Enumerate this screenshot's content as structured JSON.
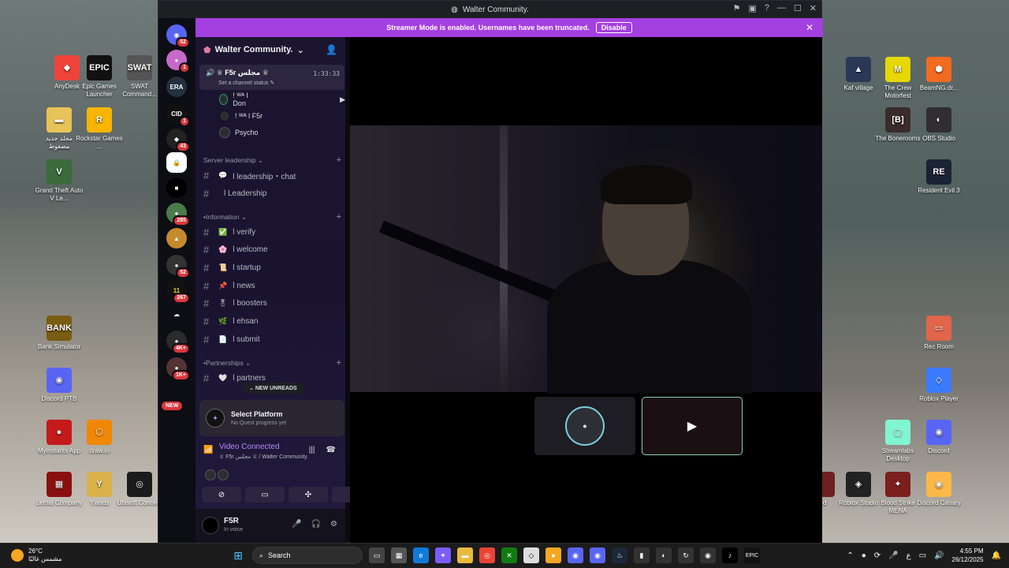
{
  "window": {
    "title": "Walter Community.",
    "streamer_notice": "Streamer Mode is enabled. Usernames have been truncated.",
    "streamer_disable": "Disable"
  },
  "rail": {
    "badges": [
      "52",
      "1",
      "1",
      "43",
      "285",
      "52",
      "267",
      "4K+",
      "1K+"
    ],
    "new_label": "NEW",
    "labels": [
      "ERA",
      "CID"
    ]
  },
  "server": {
    "name": "Walter Community.",
    "voice_channel": "♕ F5r مجلس ♕",
    "voice_time": "1:33:33",
    "voice_status": "Set a channel status",
    "voice_users": [
      "! ᵂᴬ l Don",
      "! ᵂᴬ l F5r",
      "Psycho"
    ],
    "categories": [
      {
        "name": "Server leadership"
      },
      {
        "name": "Information"
      },
      {
        "name": "Partnerships"
      }
    ],
    "channels_leadership": [
      {
        "emoji": "💬",
        "name": "l leadership・chat"
      },
      {
        "emoji": "",
        "name": "l Leadership"
      }
    ],
    "channels_info": [
      {
        "emoji": "✅",
        "name": "l verify"
      },
      {
        "emoji": "🌸",
        "name": "l welcome"
      },
      {
        "emoji": "📜",
        "name": "l startup"
      },
      {
        "emoji": "📌",
        "name": "l news"
      },
      {
        "emoji": "🎖",
        "name": "l boosters"
      },
      {
        "emoji": "🌿",
        "name": "l ehsan"
      },
      {
        "emoji": "📄",
        "name": "l submit"
      }
    ],
    "channels_partner": [
      {
        "emoji": "🤍",
        "name": "l partners"
      }
    ],
    "new_unreads": "NEW UNREADS"
  },
  "quest": {
    "title": "Select Platform",
    "subtitle": "No Quest progress yet"
  },
  "voice": {
    "status": "Video Connected",
    "location": "♕ F5r مجلس ♕ / Walter Community."
  },
  "user": {
    "name": "F5R",
    "status": "In voice"
  },
  "desktop_left": [
    {
      "label": "AnyDesk",
      "color": "#ef443b",
      "glyph": "◆"
    },
    {
      "label": "Epic Games Launcher",
      "color": "#111111",
      "glyph": "EPIC"
    },
    {
      "label": "SWAT Command...",
      "color": "#555555",
      "glyph": "SWAT"
    },
    {
      "label": "مجلد جديد مضغوط",
      "color": "#e8c35a",
      "glyph": "▬"
    },
    {
      "label": "Rockstar Games ...",
      "color": "#f7b500",
      "glyph": "R"
    },
    {
      "label": "Grand Theft Auto V Le...",
      "color": "#3c6b3c",
      "glyph": "V"
    },
    {
      "label": "Bank Simulator",
      "color": "#7a5c12",
      "glyph": "BANK"
    },
    {
      "label": "Discord PTB",
      "color": "#5865f2",
      "glyph": "◉"
    },
    {
      "label": "Myinstants App",
      "color": "#c41a1a",
      "glyph": "●"
    },
    {
      "label": "draw.io",
      "color": "#f08705",
      "glyph": "⬡"
    },
    {
      "label": "Lethal Company",
      "color": "#8a1010",
      "glyph": "▦"
    },
    {
      "label": "Ylands",
      "color": "#d9b24a",
      "glyph": "Y"
    },
    {
      "label": "Ubisoft Connect",
      "color": "#1b1b1b",
      "glyph": "◎"
    }
  ],
  "desktop_right": [
    {
      "label": "Kaf village",
      "color": "#2b3855",
      "glyph": "▲"
    },
    {
      "label": "The Crew Motorfest",
      "color": "#e6d800",
      "glyph": "M"
    },
    {
      "label": "BeamNG.dr...",
      "color": "#f26b21",
      "glyph": "⬢"
    },
    {
      "label": "The Bonerooms",
      "color": "#3b2b2b",
      "glyph": "[B]"
    },
    {
      "label": "OBS Studio",
      "color": "#302e31",
      "glyph": "◐"
    },
    {
      "label": "Resident Evil 3",
      "color": "#1b2235",
      "glyph": "RE"
    },
    {
      "label": "Rec Room",
      "color": "#e0654b",
      "glyph": "▭"
    },
    {
      "label": "Roblox Player",
      "color": "#3b7bff",
      "glyph": "◇"
    },
    {
      "label": "Streamlabs Desktop",
      "color": "#80f5d2",
      "glyph": "▢"
    },
    {
      "label": "Discord",
      "color": "#5865f2",
      "glyph": "◉"
    },
    {
      "label": "led",
      "color": "#6d2020",
      "glyph": ""
    },
    {
      "label": "Roblox Studio",
      "color": "#222222",
      "glyph": "◈"
    },
    {
      "label": "Blood Strike MENA",
      "color": "#7a1e1e",
      "glyph": "✦"
    },
    {
      "label": "Discord Canary",
      "color": "#fbb848",
      "glyph": "◉"
    }
  ],
  "taskbar": {
    "temp": "26°C",
    "weather": "مشمس غالبًا",
    "search": "Search",
    "time": "4:55 PM",
    "date": "26/12/2025",
    "lang": "ع"
  }
}
